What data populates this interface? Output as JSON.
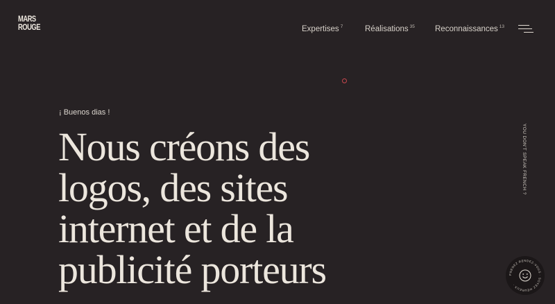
{
  "brand": {
    "logo_line1": "MARS",
    "logo_line2": "ROUGE"
  },
  "nav": {
    "items": [
      {
        "label": "Expertises",
        "count": "7"
      },
      {
        "label": "Réalisations",
        "count": "35"
      },
      {
        "label": "Reconnaissances",
        "count": "13"
      }
    ],
    "menu_icon": "hamburger-menu-icon"
  },
  "hero": {
    "greeting": "¡ Buenos dias !",
    "headline_lines": [
      "Nous créons des",
      "logos, des sites",
      "internet et de la",
      "publicité porteurs"
    ]
  },
  "side": {
    "language_note": "YOU DON'T SPEAK FRENCH ?"
  },
  "badge": {
    "ring_text": "PRENEZ RENDEZ-VOUS · SOYEZ HEUREUX ·",
    "icon": "smiley-face-icon"
  },
  "colors": {
    "background": "#272224",
    "text": "#ece6dd",
    "accent": "#c8464e"
  }
}
